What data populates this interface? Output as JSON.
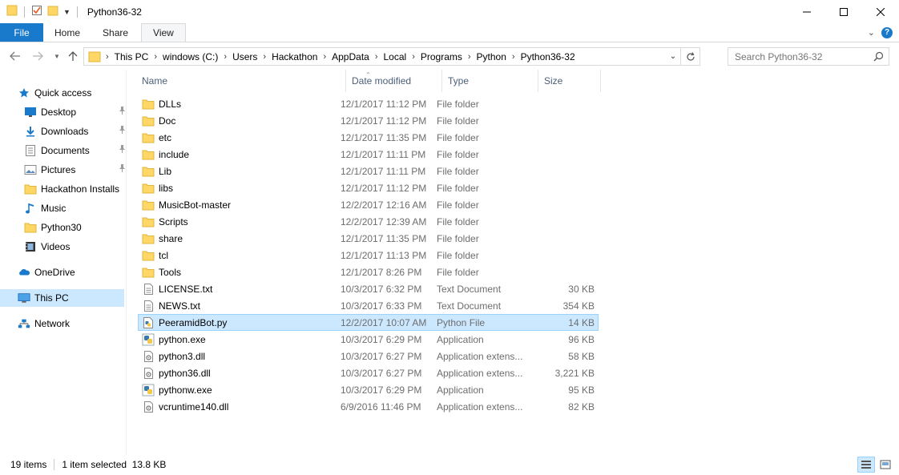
{
  "window": {
    "title": "Python36-32"
  },
  "ribbon": {
    "tabs": [
      {
        "label": "File"
      },
      {
        "label": "Home"
      },
      {
        "label": "Share"
      },
      {
        "label": "View"
      }
    ]
  },
  "address": {
    "crumbs": [
      "This PC",
      "windows (C:)",
      "Users",
      "Hackathon",
      "AppData",
      "Local",
      "Programs",
      "Python",
      "Python36-32"
    ]
  },
  "search": {
    "placeholder": "Search Python36-32"
  },
  "sidebar": {
    "items": [
      {
        "label": "Quick access",
        "icon": "star-icon",
        "pinned": false
      },
      {
        "label": "Desktop",
        "icon": "desktop-icon",
        "pinned": true
      },
      {
        "label": "Downloads",
        "icon": "download-icon",
        "pinned": true
      },
      {
        "label": "Documents",
        "icon": "documents-icon",
        "pinned": true
      },
      {
        "label": "Pictures",
        "icon": "pictures-icon",
        "pinned": true
      },
      {
        "label": "Hackathon Installs",
        "icon": "folder-icon",
        "pinned": false
      },
      {
        "label": "Music",
        "icon": "music-icon",
        "pinned": false
      },
      {
        "label": "Python30",
        "icon": "folder-icon",
        "pinned": false
      },
      {
        "label": "Videos",
        "icon": "videos-icon",
        "pinned": false
      },
      {
        "label": "OneDrive",
        "icon": "onedrive-icon",
        "pinned": false
      },
      {
        "label": "This PC",
        "icon": "computer-icon",
        "pinned": false,
        "selected": true
      },
      {
        "label": "Network",
        "icon": "network-icon",
        "pinned": false
      }
    ]
  },
  "columns": {
    "name": "Name",
    "date": "Date modified",
    "type": "Type",
    "size": "Size"
  },
  "files": [
    {
      "name": "DLLs",
      "date": "12/1/2017 11:12 PM",
      "type": "File folder",
      "size": "",
      "icon": "folder-icon"
    },
    {
      "name": "Doc",
      "date": "12/1/2017 11:12 PM",
      "type": "File folder",
      "size": "",
      "icon": "folder-icon"
    },
    {
      "name": "etc",
      "date": "12/1/2017 11:35 PM",
      "type": "File folder",
      "size": "",
      "icon": "folder-icon"
    },
    {
      "name": "include",
      "date": "12/1/2017 11:11 PM",
      "type": "File folder",
      "size": "",
      "icon": "folder-icon"
    },
    {
      "name": "Lib",
      "date": "12/1/2017 11:11 PM",
      "type": "File folder",
      "size": "",
      "icon": "folder-icon"
    },
    {
      "name": "libs",
      "date": "12/1/2017 11:12 PM",
      "type": "File folder",
      "size": "",
      "icon": "folder-icon"
    },
    {
      "name": "MusicBot-master",
      "date": "12/2/2017 12:16 AM",
      "type": "File folder",
      "size": "",
      "icon": "folder-icon"
    },
    {
      "name": "Scripts",
      "date": "12/2/2017 12:39 AM",
      "type": "File folder",
      "size": "",
      "icon": "folder-icon"
    },
    {
      "name": "share",
      "date": "12/1/2017 11:35 PM",
      "type": "File folder",
      "size": "",
      "icon": "folder-icon"
    },
    {
      "name": "tcl",
      "date": "12/1/2017 11:13 PM",
      "type": "File folder",
      "size": "",
      "icon": "folder-icon"
    },
    {
      "name": "Tools",
      "date": "12/1/2017 8:26 PM",
      "type": "File folder",
      "size": "",
      "icon": "folder-icon"
    },
    {
      "name": "LICENSE.txt",
      "date": "10/3/2017 6:32 PM",
      "type": "Text Document",
      "size": "30 KB",
      "icon": "text-file-icon"
    },
    {
      "name": "NEWS.txt",
      "date": "10/3/2017 6:33 PM",
      "type": "Text Document",
      "size": "354 KB",
      "icon": "text-file-icon"
    },
    {
      "name": "PeeramidBot.py",
      "date": "12/2/2017 10:07 AM",
      "type": "Python File",
      "size": "14 KB",
      "icon": "python-file-icon",
      "selected": true
    },
    {
      "name": "python.exe",
      "date": "10/3/2017 6:29 PM",
      "type": "Application",
      "size": "96 KB",
      "icon": "python-exe-icon"
    },
    {
      "name": "python3.dll",
      "date": "10/3/2017 6:27 PM",
      "type": "Application extens...",
      "size": "58 KB",
      "icon": "dll-icon"
    },
    {
      "name": "python36.dll",
      "date": "10/3/2017 6:27 PM",
      "type": "Application extens...",
      "size": "3,221 KB",
      "icon": "dll-icon"
    },
    {
      "name": "pythonw.exe",
      "date": "10/3/2017 6:29 PM",
      "type": "Application",
      "size": "95 KB",
      "icon": "python-exe-icon"
    },
    {
      "name": "vcruntime140.dll",
      "date": "6/9/2016 11:46 PM",
      "type": "Application extens...",
      "size": "82 KB",
      "icon": "dll-icon"
    }
  ],
  "status": {
    "count": "19 items",
    "selection": "1 item selected  13.8 KB"
  },
  "colors": {
    "accent": "#1979ca",
    "selection": "#cce8ff",
    "selection_border": "#99d1ff",
    "folder": "#ffd766"
  }
}
